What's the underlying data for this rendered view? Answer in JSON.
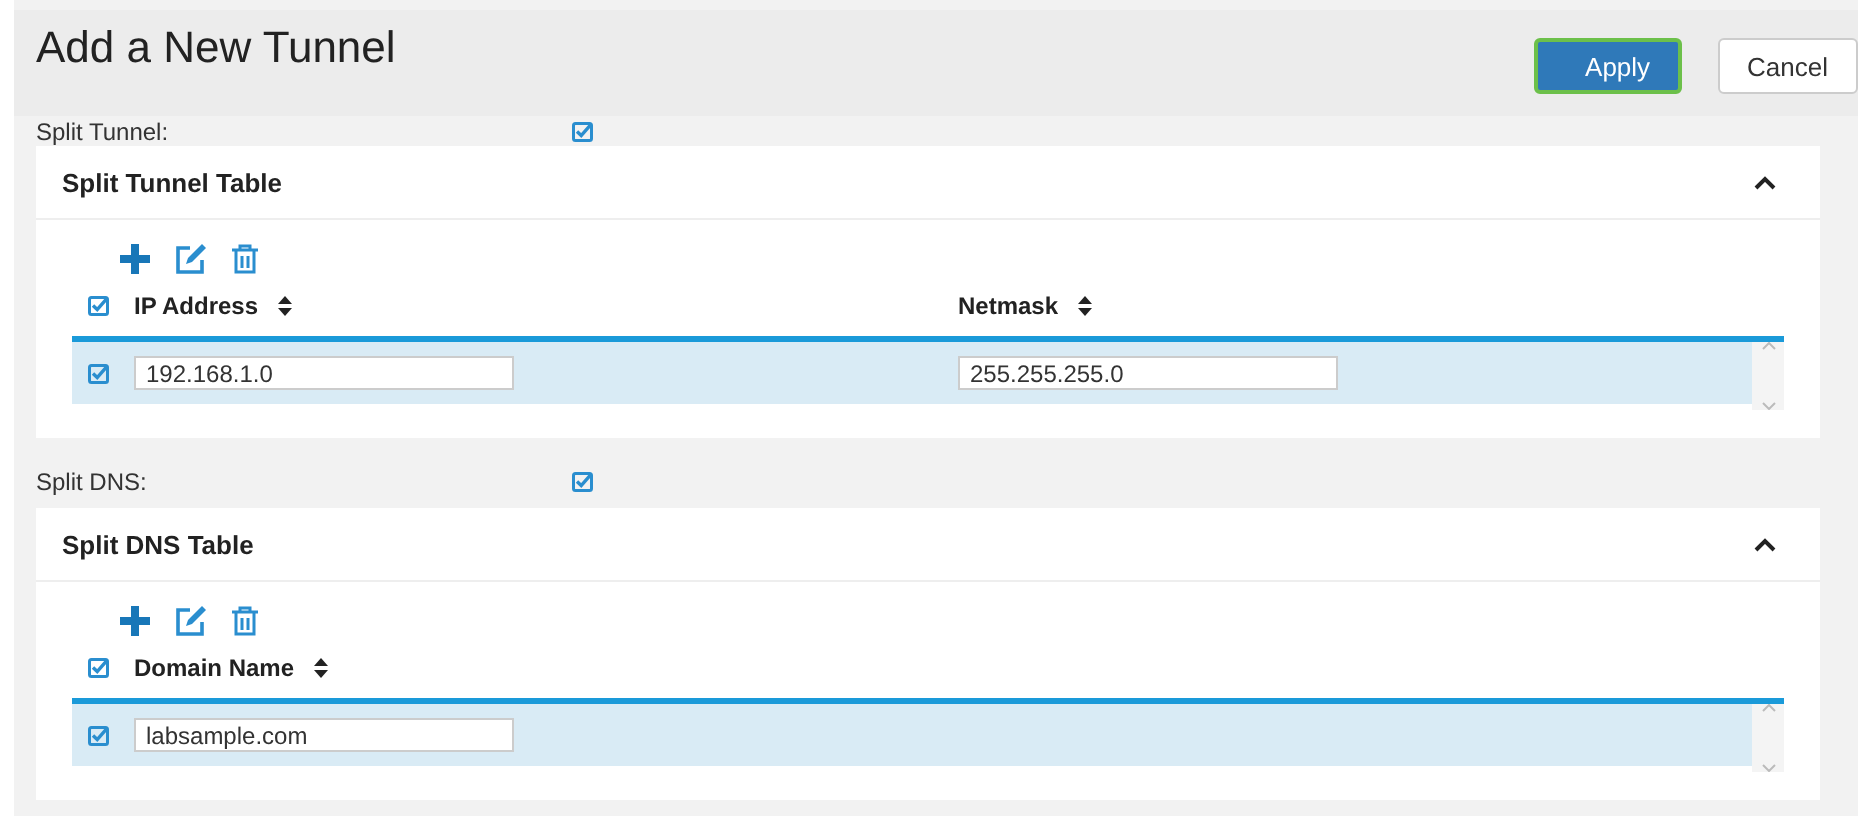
{
  "header": {
    "title": "Add a New Tunnel",
    "buttons": [
      {
        "label": "Apply",
        "kind": "primary",
        "focused": true
      },
      {
        "label": "Cancel",
        "kind": "secondary",
        "focused": false
      }
    ]
  },
  "sections": [
    {
      "label": "Split Tunnel:",
      "checked": true,
      "table": {
        "title": "Split Tunnel Table",
        "expanded": true,
        "select_all_checked": true,
        "columns": [
          "IP Address",
          "Netmask"
        ],
        "rows": [
          {
            "checked": true,
            "selected": true,
            "cells": [
              "192.168.1.0",
              "255.255.255.0"
            ]
          }
        ]
      }
    },
    {
      "label": "Split DNS:",
      "checked": true,
      "table": {
        "title": "Split DNS Table",
        "expanded": true,
        "select_all_checked": true,
        "columns": [
          "Domain Name"
        ],
        "rows": [
          {
            "checked": true,
            "selected": true,
            "cells": [
              "labsample.com"
            ]
          }
        ]
      }
    }
  ]
}
